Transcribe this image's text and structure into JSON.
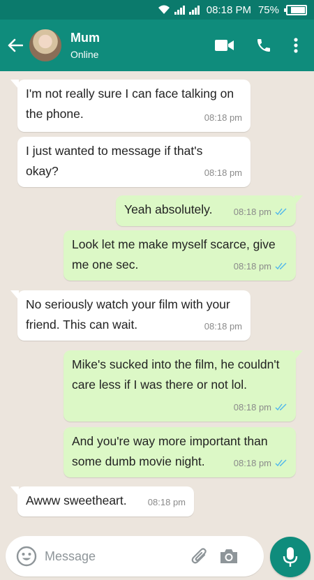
{
  "status_bar": {
    "time": "08:18 PM",
    "battery": "75%"
  },
  "contact": {
    "name": "Mum",
    "status": "Online"
  },
  "messages": [
    {
      "direction": "in",
      "text": "I'm not really sure I can face talking on the phone.",
      "time": "08:18 pm"
    },
    {
      "direction": "in",
      "text": "I just wanted to message if that's okay?",
      "time": "08:18 pm"
    },
    {
      "direction": "out",
      "text": "Yeah absolutely.",
      "time": "08:18 pm",
      "read": true
    },
    {
      "direction": "out",
      "text": "Look let me make myself scarce, give me one sec.",
      "time": "08:18 pm",
      "read": true
    },
    {
      "direction": "in",
      "text": "No seriously watch your film with your friend. This can wait.",
      "time": "08:18 pm"
    },
    {
      "direction": "out",
      "text": "Mike's sucked into the film, he couldn't care less if I was there or not lol.",
      "time": "08:18 pm",
      "read": true
    },
    {
      "direction": "out",
      "text": "And you're way more important than some dumb movie night.",
      "time": "08:18 pm",
      "read": true
    },
    {
      "direction": "in",
      "text": "Awww sweetheart.",
      "time": "08:18 pm"
    }
  ],
  "composer": {
    "placeholder": "Message"
  },
  "colors": {
    "header": "#0f8c7c",
    "status_bar": "#0b7a6c",
    "incoming": "#ffffff",
    "outgoing": "#dcf8c6",
    "read_ticks": "#4fb6ec"
  },
  "icons": [
    "back-arrow-icon",
    "video-call-icon",
    "phone-icon",
    "more-vert-icon",
    "emoji-icon",
    "attach-icon",
    "camera-icon",
    "mic-icon",
    "wifi-icon",
    "signal-icon",
    "battery-icon"
  ]
}
